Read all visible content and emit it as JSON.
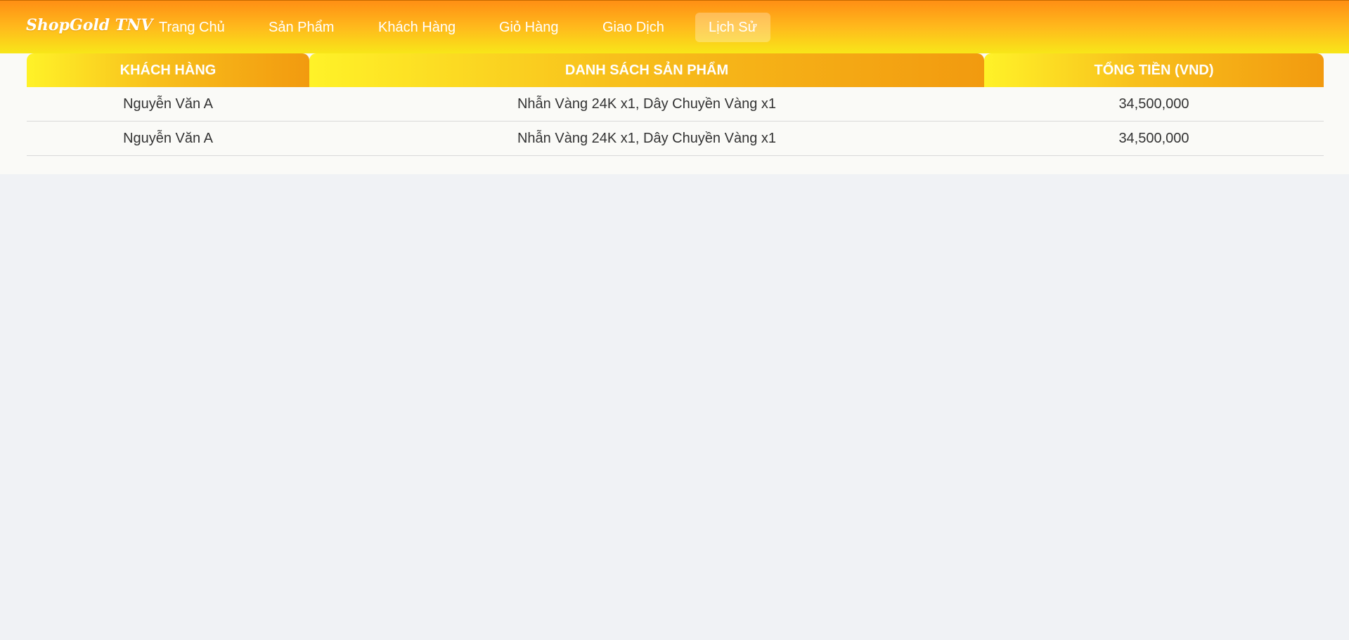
{
  "brand": "ShopGold TNV",
  "nav": {
    "items": [
      {
        "label": "Trang Chủ",
        "active": false
      },
      {
        "label": "Sản Phẩm",
        "active": false
      },
      {
        "label": "Khách Hàng",
        "active": false
      },
      {
        "label": "Giỏ Hàng",
        "active": false
      },
      {
        "label": "Giao Dịch",
        "active": false
      },
      {
        "label": "Lịch Sử",
        "active": true
      }
    ]
  },
  "table": {
    "headers": [
      "KHÁCH HÀNG",
      "DANH SÁCH SẢN PHẨM",
      "TỔNG TIỀN (VND)"
    ],
    "rows": [
      {
        "customer": "Nguyễn Văn A",
        "products": "Nhẫn Vàng 24K x1, Dây Chuyền Vàng x1",
        "total": "34,500,000"
      },
      {
        "customer": "Nguyễn Văn A",
        "products": "Nhẫn Vàng 24K x1, Dây Chuyền Vàng x1",
        "total": "34,500,000"
      }
    ]
  },
  "colors": {
    "nav_gradient_top": "#ff8f14",
    "nav_gradient_bottom": "#f8e619",
    "header_gradient_start": "#fff228",
    "header_gradient_end": "#f29a0f",
    "page_background": "#f0f2f5",
    "panel_background": "#fafaf7",
    "text": "#333333"
  }
}
